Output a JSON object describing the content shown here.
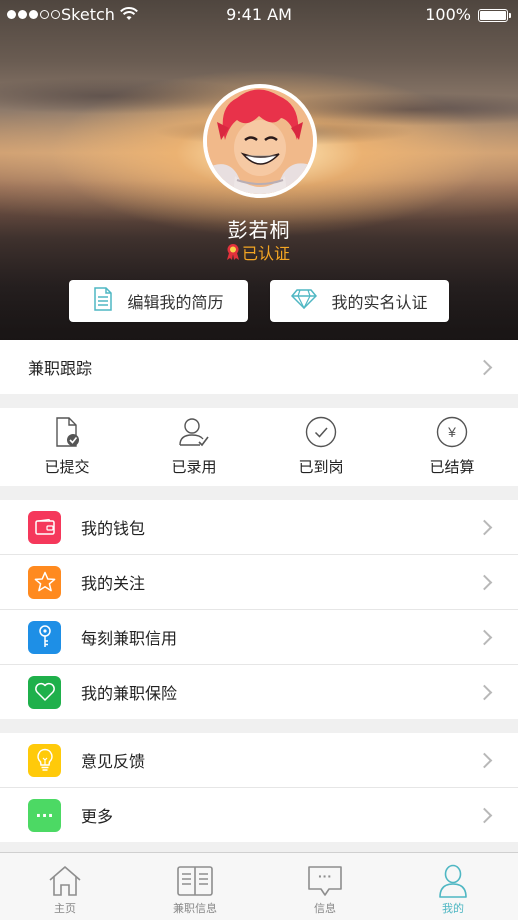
{
  "status_bar": {
    "carrier": "Sketch",
    "time": "9:41 AM",
    "battery": "100%"
  },
  "profile": {
    "name": "彭若桐",
    "verified_text": "已认证",
    "edit_resume_label": "编辑我的简历",
    "real_name_label": "我的实名认证"
  },
  "tracking": {
    "title": "兼职跟踪",
    "stages": [
      {
        "label": "已提交",
        "icon": "document-check-icon"
      },
      {
        "label": "已录用",
        "icon": "user-check-icon"
      },
      {
        "label": "已到岗",
        "icon": "circle-check-icon"
      },
      {
        "label": "已结算",
        "icon": "yen-circle-icon",
        "symbol": "¥"
      }
    ]
  },
  "menu": [
    {
      "label": "我的钱包",
      "icon": "wallet-icon",
      "color": "#f5385b"
    },
    {
      "label": "我的关注",
      "icon": "star-icon",
      "color": "#ff8a1f"
    },
    {
      "label": "每刻兼职信用",
      "icon": "key-icon",
      "color": "#1e8fe6"
    },
    {
      "label": "我的兼职保险",
      "icon": "heart-icon",
      "color": "#1fb04b"
    }
  ],
  "menu2": [
    {
      "label": "意见反馈",
      "icon": "lightbulb-icon",
      "color": "#ffca0a"
    },
    {
      "label": "更多",
      "icon": "more-dots-icon",
      "color": "#4cd964",
      "symbol": "···"
    }
  ],
  "tabs": [
    {
      "label": "主页",
      "icon": "home-icon"
    },
    {
      "label": "兼职信息",
      "icon": "book-icon"
    },
    {
      "label": "信息",
      "icon": "message-icon",
      "symbol": "···"
    },
    {
      "label": "我的",
      "icon": "person-icon",
      "active": true
    }
  ],
  "colors": {
    "accent": "#4fb7c3",
    "verified": "#f5a623"
  }
}
